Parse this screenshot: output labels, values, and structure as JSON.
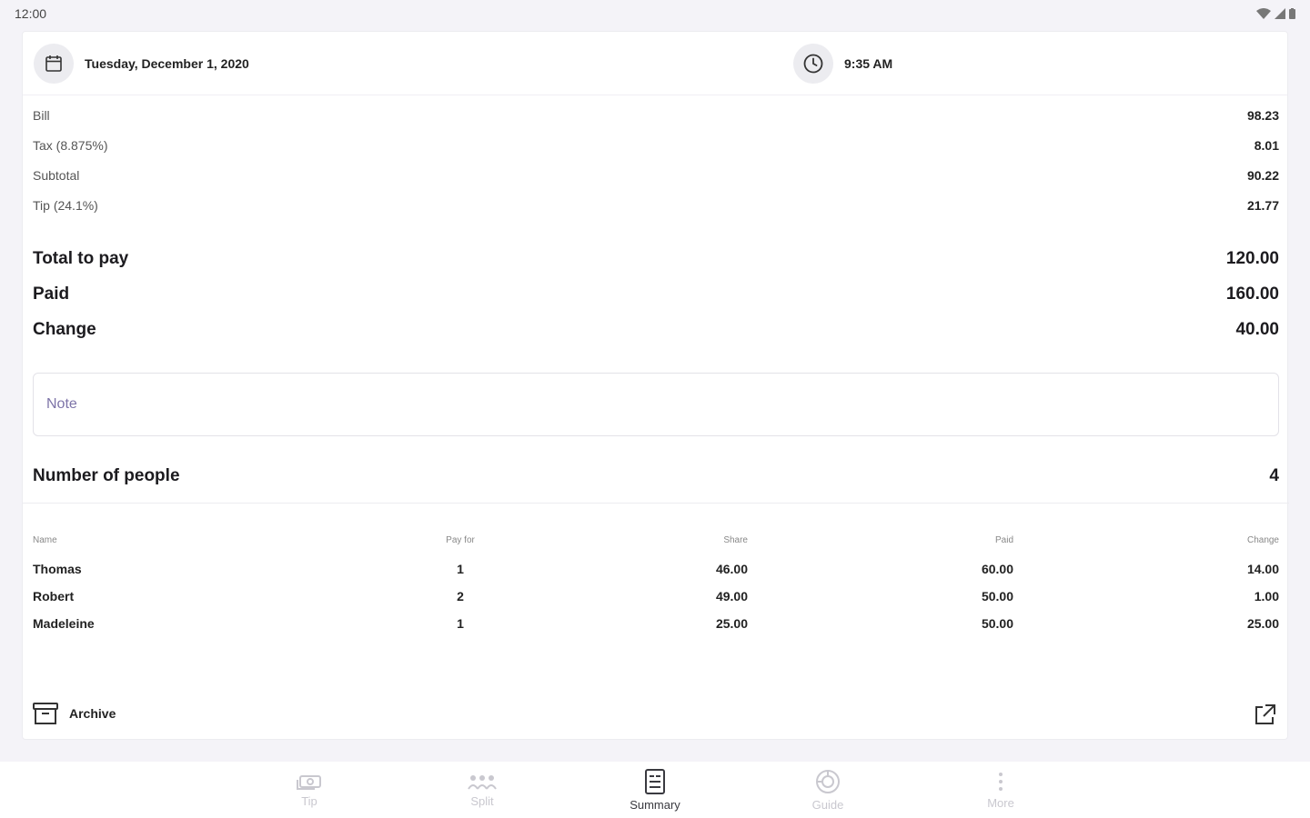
{
  "status_bar": {
    "time": "12:00"
  },
  "header": {
    "date": "Tuesday, December 1, 2020",
    "time": "9:35 AM"
  },
  "breakdown": [
    {
      "label": "Bill",
      "value": "98.23"
    },
    {
      "label": "Tax (8.875%)",
      "value": "8.01"
    },
    {
      "label": "Subtotal",
      "value": "90.22"
    },
    {
      "label": "Tip (24.1%)",
      "value": "21.77"
    }
  ],
  "totals": [
    {
      "label": "Total to pay",
      "value": "120.00"
    },
    {
      "label": "Paid",
      "value": "160.00"
    },
    {
      "label": "Change",
      "value": "40.00"
    }
  ],
  "note": {
    "placeholder": "Note"
  },
  "people": {
    "label": "Number of people",
    "value": "4"
  },
  "table": {
    "headers": {
      "name": "Name",
      "pay_for": "Pay for",
      "share": "Share",
      "paid": "Paid",
      "change": "Change"
    },
    "rows": [
      {
        "name": "Thomas",
        "pay_for": "1",
        "share": "46.00",
        "paid": "60.00",
        "change": "14.00"
      },
      {
        "name": "Robert",
        "pay_for": "2",
        "share": "49.00",
        "paid": "50.00",
        "change": "1.00"
      },
      {
        "name": "Madeleine",
        "pay_for": "1",
        "share": "25.00",
        "paid": "50.00",
        "change": "25.00"
      }
    ]
  },
  "actions": {
    "archive_label": "Archive"
  },
  "nav": {
    "tip": "Tip",
    "split": "Split",
    "summary": "Summary",
    "guide": "Guide",
    "more": "More",
    "active": "summary"
  }
}
